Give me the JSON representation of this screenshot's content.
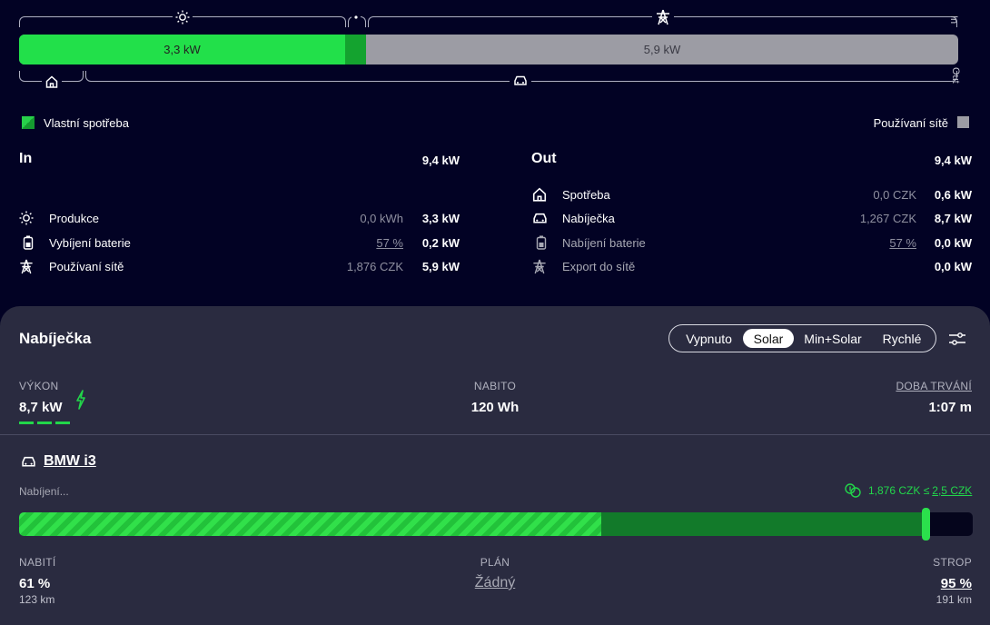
{
  "flow": {
    "in_label": "In",
    "out_label": "Out",
    "solar_segment": "3,3 kW",
    "grid_segment": "5,9 kW",
    "solar_fraction": 0.347,
    "battery_fraction": 0.022,
    "grid_fraction": 0.631
  },
  "legend": {
    "self_consumption": "Vlastní spotřeba",
    "grid_use": "Používaní sítě"
  },
  "in_table": {
    "title": "In",
    "total": "9,4 kW",
    "rows": [
      {
        "icon": "sun-icon",
        "label": "Produkce",
        "detail": "0,0 kWh",
        "value": "3,3 kW"
      },
      {
        "icon": "battery-icon",
        "label": "Vybíjení baterie",
        "detail": "57 %",
        "value": "0,2 kW"
      },
      {
        "icon": "power-tower-icon",
        "label": "Používaní sítě",
        "detail": "1,876 CZK",
        "value": "5,9 kW"
      }
    ]
  },
  "out_table": {
    "title": "Out",
    "total": "9,4 kW",
    "rows": [
      {
        "icon": "home-icon",
        "label": "Spotřeba",
        "detail": "0,0 CZK",
        "value": "0,6 kW"
      },
      {
        "icon": "car-icon",
        "label": "Nabíječka",
        "detail": "1,267 CZK",
        "value": "8,7 kW"
      },
      {
        "icon": "battery-icon",
        "label": "Nabíjení baterie",
        "detail": "57 %",
        "value": "0,0 kW"
      },
      {
        "icon": "power-tower-icon",
        "label": "Export do sítě",
        "detail": "",
        "value": "0,0 kW"
      }
    ]
  },
  "charger": {
    "title": "Nabíječka",
    "modes": [
      "Vypnuto",
      "Solar",
      "Min+Solar",
      "Rychlé"
    ],
    "active_mode": "Solar",
    "power_label": "VÝKON",
    "power_value": "8,7 kW",
    "charged_label": "NABITO",
    "charged_value": "120 Wh",
    "duration_label": "DOBA TRVÁNÍ",
    "duration_value": "1:07 m"
  },
  "vehicle": {
    "name": "BMW i3",
    "status": "Nabíjení...",
    "price_text": "1,876 CZK ≤",
    "price_limit": "2,5 CZK",
    "soc_fraction": 0.61,
    "limit_fraction": 0.95,
    "soc_label": "NABITÍ",
    "soc_value": "61 %",
    "soc_range": "123 km",
    "plan_label": "PLÁN",
    "plan_value": "Žádný",
    "limit_label": "STROP",
    "limit_value": "95 %",
    "limit_range": "191 km"
  },
  "colors": {
    "background": "#020224",
    "panel": "#2a2b40",
    "solar_green": "#22e04a",
    "battery_green": "#14a32f",
    "grid_gray": "#9c9ca4"
  }
}
